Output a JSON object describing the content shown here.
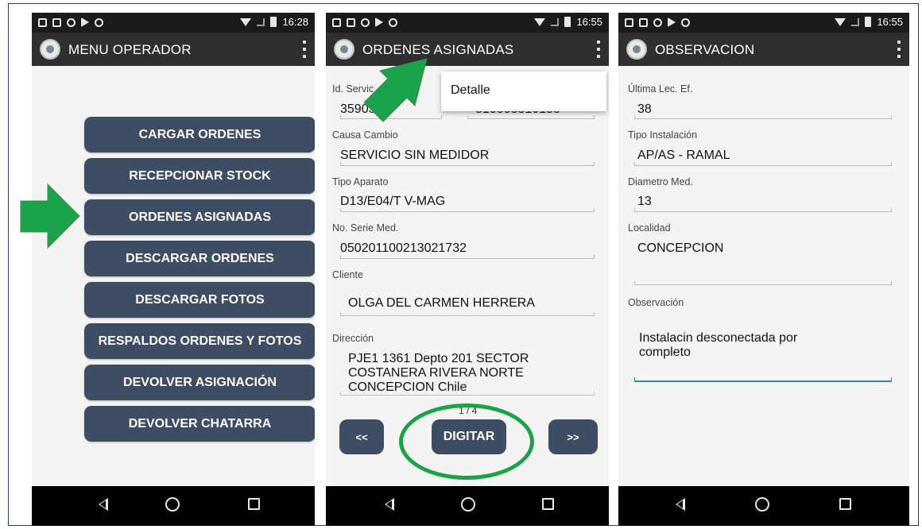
{
  "status_times": [
    "16:28",
    "16:55",
    "16:55"
  ],
  "phone1": {
    "title": "MENU OPERADOR",
    "menu_items": [
      "CARGAR ORDENES",
      "RECEPCIONAR STOCK",
      "ORDENES ASIGNADAS",
      "DESCARGAR ORDENES",
      "DESCARGAR FOTOS",
      "RESPALDOS ORDENES Y FOTOS",
      "DEVOLVER ASIGNACIÓN",
      "DEVOLVER CHATARRA"
    ]
  },
  "phone2": {
    "title": "ORDENES ASIGNADAS",
    "popup_item": "Detalle",
    "id_label": "Id. Servic",
    "id_value": "3590332",
    "id_value2": "810803310158",
    "causa_label": "Causa Cambio",
    "causa_value": "SERVICIO SIN MEDIDOR",
    "tipo_label": "Tipo Aparato",
    "tipo_value": "D13/E04/T V-MAG",
    "serie_label": "No. Serie Med.",
    "serie_value": "050201100213021732",
    "cliente_label": "Cliente",
    "cliente_value": "OLGA DEL CARMEN HERRERA",
    "direccion_label": "Dirección",
    "direccion_line1": "PJE1 1361 Depto 201 SECTOR",
    "direccion_line2": "COSTANERA RIVERA NORTE",
    "direccion_line3": "CONCEPCION Chile",
    "pager": "1 / 4",
    "prev_label": "<<",
    "digitar_label": "DIGITAR",
    "next_label": ">>"
  },
  "phone3": {
    "title": "OBSERVACION",
    "ultima_label": "Última Lec. Ef.",
    "ultima_value": "38",
    "tipo_inst_label": "Tipo Instalación",
    "tipo_inst_value": "AP/AS - RAMAL",
    "diametro_label": "Diametro Med.",
    "diametro_value": "13",
    "localidad_label": "Localidad",
    "localidad_value": "CONCEPCION",
    "observacion_label": "Observación",
    "observacion_line1": "Instalacin desconectada por",
    "observacion_line2": "completo"
  },
  "colors": {
    "button": "#3e4c64",
    "arrow_green": "#1aa34a",
    "ellipse_green": "#17a445",
    "focus_blue": "#3a7fc1"
  },
  "icons": [
    "back-icon",
    "home-icon",
    "recents-icon",
    "kebab-menu-icon",
    "app-logo-icon",
    "wifi-icon",
    "battery-icon",
    "arrow-pointer-icon"
  ]
}
